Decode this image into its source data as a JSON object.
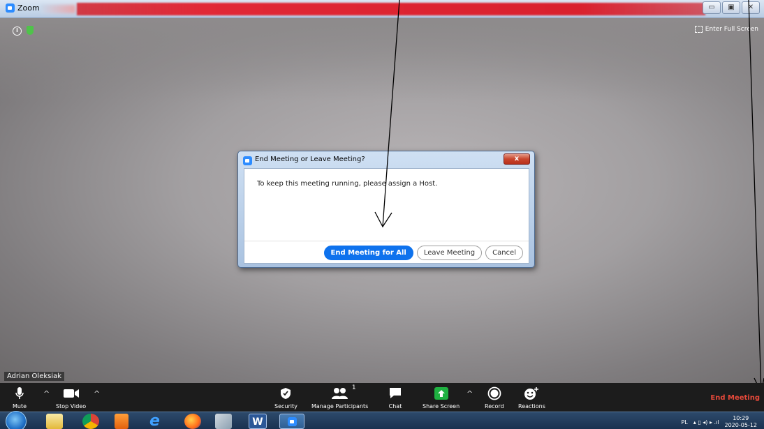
{
  "window": {
    "app_title": "Zoom",
    "buttons": [
      "▭",
      "▣",
      "✕"
    ]
  },
  "video": {
    "fullscreen_label": "Enter Full Screen",
    "participant_name": "Adrian Oleksiak"
  },
  "dialog": {
    "title": "End Meeting or Leave Meeting?",
    "message": "To keep this meeting running, please assign a Host.",
    "close_label": "x",
    "end_for_all_label": "End Meeting for All",
    "leave_label": "Leave Meeting",
    "cancel_label": "Cancel"
  },
  "toolbar": {
    "mute_label": "Mute",
    "stop_video_label": "Stop Video",
    "security_label": "Security",
    "participants_label": "Manage Participants",
    "participants_count": "1",
    "chat_label": "Chat",
    "share_label": "Share Screen",
    "record_label": "Record",
    "reactions_label": "Reactions",
    "end_meeting_label": "End Meeting",
    "caret": "^"
  },
  "taskbar": {
    "language": "PL",
    "time": "10:29",
    "date": "2020-05-12"
  },
  "colors": {
    "zoom_blue": "#0e72ed",
    "end_red": "#e5493a",
    "share_green": "#1fb141"
  }
}
